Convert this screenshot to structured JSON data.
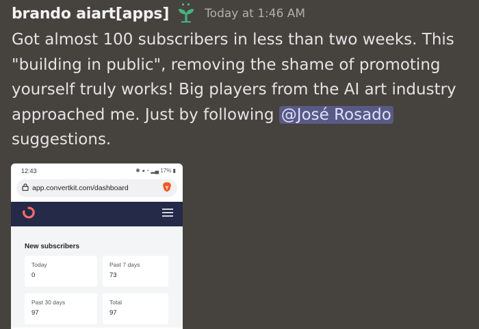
{
  "message": {
    "username": "brando aiart[apps]",
    "timestamp": "Today at 1:46 AM",
    "text_before": "Got almost 100 subscribers in less than two weeks. This \"building in public\", removing the shame of promoting yourself truly works! Big players from the AI art industry approached me. Just  by following ",
    "mention": "@José Rosado",
    "text_after": " suggestions.",
    "role_icon": "sprout-icon",
    "colors": {
      "background": "#46433e",
      "mention_bg": "#585a86",
      "role_icon": "#43b581"
    }
  },
  "screenshot": {
    "time": "12:43",
    "battery": "17%",
    "url": "app.convertkit.com/dashboard",
    "section_title": "New subscribers",
    "stats": [
      {
        "label": "Today",
        "value": "0"
      },
      {
        "label": "Past 7 days",
        "value": "73"
      },
      {
        "label": "Past 30 days",
        "value": "97"
      },
      {
        "label": "Total",
        "value": "97"
      }
    ]
  }
}
